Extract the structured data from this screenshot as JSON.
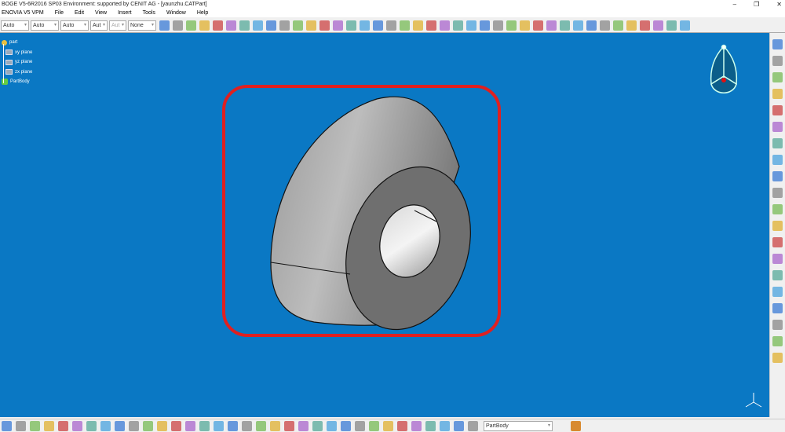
{
  "title": "BOGE V5-6R2016 SP03 Environment: supported by CENIT AG - [yaunzhu.CATPart]",
  "window_controls": {
    "minimize": "–",
    "restore": "❐",
    "close": "✕"
  },
  "menu": [
    "ENOVIA V5 VPM",
    "File",
    "Edit",
    "View",
    "Insert",
    "Tools",
    "Window",
    "Help"
  ],
  "toolbar": {
    "combos": [
      {
        "value": "Auto",
        "w": 36
      },
      {
        "value": "Auto",
        "w": 36
      },
      {
        "value": "Auto",
        "w": 36
      },
      {
        "value": "Aut",
        "w": 22
      },
      {
        "value": "Aut",
        "w": 22
      },
      {
        "value": "None",
        "w": 36
      }
    ],
    "icon_count": 48
  },
  "tree": {
    "root": "part",
    "items": [
      "xy plane",
      "yz plane",
      "zx plane"
    ],
    "body": "PartBody"
  },
  "bottombar": {
    "icon_count": 44,
    "body_select": "PartBody"
  },
  "rightbar": {
    "icon_count": 20
  },
  "colors": {
    "viewport": "#0a78c4",
    "highlight": "#e02020",
    "part": "#8a8a8a"
  }
}
